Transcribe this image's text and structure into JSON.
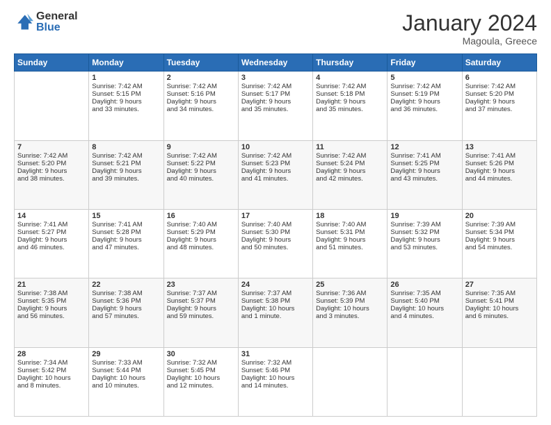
{
  "logo": {
    "general": "General",
    "blue": "Blue"
  },
  "header": {
    "month": "January 2024",
    "location": "Magoula, Greece"
  },
  "days_of_week": [
    "Sunday",
    "Monday",
    "Tuesday",
    "Wednesday",
    "Thursday",
    "Friday",
    "Saturday"
  ],
  "weeks": [
    [
      {
        "num": "",
        "data": ""
      },
      {
        "num": "1",
        "data": "Sunrise: 7:42 AM\nSunset: 5:15 PM\nDaylight: 9 hours\nand 33 minutes."
      },
      {
        "num": "2",
        "data": "Sunrise: 7:42 AM\nSunset: 5:16 PM\nDaylight: 9 hours\nand 34 minutes."
      },
      {
        "num": "3",
        "data": "Sunrise: 7:42 AM\nSunset: 5:17 PM\nDaylight: 9 hours\nand 35 minutes."
      },
      {
        "num": "4",
        "data": "Sunrise: 7:42 AM\nSunset: 5:18 PM\nDaylight: 9 hours\nand 35 minutes."
      },
      {
        "num": "5",
        "data": "Sunrise: 7:42 AM\nSunset: 5:19 PM\nDaylight: 9 hours\nand 36 minutes."
      },
      {
        "num": "6",
        "data": "Sunrise: 7:42 AM\nSunset: 5:20 PM\nDaylight: 9 hours\nand 37 minutes."
      }
    ],
    [
      {
        "num": "7",
        "data": "Sunrise: 7:42 AM\nSunset: 5:20 PM\nDaylight: 9 hours\nand 38 minutes."
      },
      {
        "num": "8",
        "data": "Sunrise: 7:42 AM\nSunset: 5:21 PM\nDaylight: 9 hours\nand 39 minutes."
      },
      {
        "num": "9",
        "data": "Sunrise: 7:42 AM\nSunset: 5:22 PM\nDaylight: 9 hours\nand 40 minutes."
      },
      {
        "num": "10",
        "data": "Sunrise: 7:42 AM\nSunset: 5:23 PM\nDaylight: 9 hours\nand 41 minutes."
      },
      {
        "num": "11",
        "data": "Sunrise: 7:42 AM\nSunset: 5:24 PM\nDaylight: 9 hours\nand 42 minutes."
      },
      {
        "num": "12",
        "data": "Sunrise: 7:41 AM\nSunset: 5:25 PM\nDaylight: 9 hours\nand 43 minutes."
      },
      {
        "num": "13",
        "data": "Sunrise: 7:41 AM\nSunset: 5:26 PM\nDaylight: 9 hours\nand 44 minutes."
      }
    ],
    [
      {
        "num": "14",
        "data": "Sunrise: 7:41 AM\nSunset: 5:27 PM\nDaylight: 9 hours\nand 46 minutes."
      },
      {
        "num": "15",
        "data": "Sunrise: 7:41 AM\nSunset: 5:28 PM\nDaylight: 9 hours\nand 47 minutes."
      },
      {
        "num": "16",
        "data": "Sunrise: 7:40 AM\nSunset: 5:29 PM\nDaylight: 9 hours\nand 48 minutes."
      },
      {
        "num": "17",
        "data": "Sunrise: 7:40 AM\nSunset: 5:30 PM\nDaylight: 9 hours\nand 50 minutes."
      },
      {
        "num": "18",
        "data": "Sunrise: 7:40 AM\nSunset: 5:31 PM\nDaylight: 9 hours\nand 51 minutes."
      },
      {
        "num": "19",
        "data": "Sunrise: 7:39 AM\nSunset: 5:32 PM\nDaylight: 9 hours\nand 53 minutes."
      },
      {
        "num": "20",
        "data": "Sunrise: 7:39 AM\nSunset: 5:34 PM\nDaylight: 9 hours\nand 54 minutes."
      }
    ],
    [
      {
        "num": "21",
        "data": "Sunrise: 7:38 AM\nSunset: 5:35 PM\nDaylight: 9 hours\nand 56 minutes."
      },
      {
        "num": "22",
        "data": "Sunrise: 7:38 AM\nSunset: 5:36 PM\nDaylight: 9 hours\nand 57 minutes."
      },
      {
        "num": "23",
        "data": "Sunrise: 7:37 AM\nSunset: 5:37 PM\nDaylight: 9 hours\nand 59 minutes."
      },
      {
        "num": "24",
        "data": "Sunrise: 7:37 AM\nSunset: 5:38 PM\nDaylight: 10 hours\nand 1 minute."
      },
      {
        "num": "25",
        "data": "Sunrise: 7:36 AM\nSunset: 5:39 PM\nDaylight: 10 hours\nand 3 minutes."
      },
      {
        "num": "26",
        "data": "Sunrise: 7:35 AM\nSunset: 5:40 PM\nDaylight: 10 hours\nand 4 minutes."
      },
      {
        "num": "27",
        "data": "Sunrise: 7:35 AM\nSunset: 5:41 PM\nDaylight: 10 hours\nand 6 minutes."
      }
    ],
    [
      {
        "num": "28",
        "data": "Sunrise: 7:34 AM\nSunset: 5:42 PM\nDaylight: 10 hours\nand 8 minutes."
      },
      {
        "num": "29",
        "data": "Sunrise: 7:33 AM\nSunset: 5:44 PM\nDaylight: 10 hours\nand 10 minutes."
      },
      {
        "num": "30",
        "data": "Sunrise: 7:32 AM\nSunset: 5:45 PM\nDaylight: 10 hours\nand 12 minutes."
      },
      {
        "num": "31",
        "data": "Sunrise: 7:32 AM\nSunset: 5:46 PM\nDaylight: 10 hours\nand 14 minutes."
      },
      {
        "num": "",
        "data": ""
      },
      {
        "num": "",
        "data": ""
      },
      {
        "num": "",
        "data": ""
      }
    ]
  ]
}
